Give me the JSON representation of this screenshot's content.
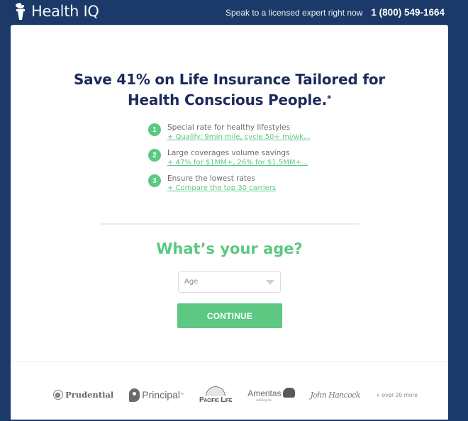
{
  "header": {
    "brand_name": "Health IQ",
    "contact_text": "Speak to a licensed expert right now",
    "phone": "1 (800) 549-1664"
  },
  "hero": {
    "headline_line1": "Save 41% on Life Insurance Tailored for",
    "headline_line2": "Health Conscious People.",
    "footnote_marker": "*"
  },
  "benefits": [
    {
      "number": "1",
      "title": "Special rate for healthy lifestyles",
      "link": "+ Qualify: 9min mile, cycle 50+ mi/wk..."
    },
    {
      "number": "2",
      "title": "Large coverages volume savings",
      "link": "+ 47% for $1MM+, 26% for $1.5MM+..."
    },
    {
      "number": "3",
      "title": "Ensure the lowest rates",
      "link": "+ Compare the top 30 carriers"
    }
  ],
  "form": {
    "question": "What’s your age?",
    "age_select": {
      "placeholder": "Age",
      "value": ""
    },
    "continue_label": "CONTINUE"
  },
  "carriers": {
    "logos": [
      {
        "name": "Prudential"
      },
      {
        "name": "Principal",
        "mark": "™"
      },
      {
        "name": "Pacific Life"
      },
      {
        "name": "Ameritas",
        "tagline": "fulfilling life."
      },
      {
        "name": "John Hancock"
      }
    ],
    "more_text": "+ over 20 more"
  },
  "colors": {
    "background": "#1b3a69",
    "accent_green": "#5cc882",
    "headline_navy": "#1d2a5c"
  }
}
